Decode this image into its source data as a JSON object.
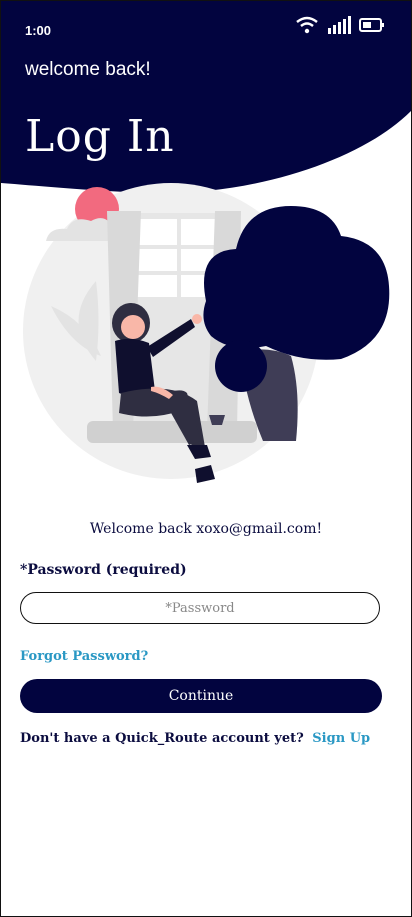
{
  "status_bar": {
    "time": "1:00",
    "icons": [
      "wifi-icon",
      "signal-icon",
      "battery-icon"
    ]
  },
  "header": {
    "subtitle": "welcome back!",
    "title": "Log In"
  },
  "colors": {
    "navy": "#02043f",
    "accent_pink": "#f26a7f",
    "link_blue": "#2a98c4",
    "grey_light": "#eeeeee"
  },
  "form": {
    "welcome_line": "Welcome back xoxo@gmail.com!",
    "password_label": "*Password (required)",
    "password_placeholder": "*Password",
    "forgot_link": "Forgot Password?",
    "continue_label": "Continue",
    "signup_prompt": "Don't have a Quick_Route account yet?",
    "signup_link": "Sign Up"
  }
}
